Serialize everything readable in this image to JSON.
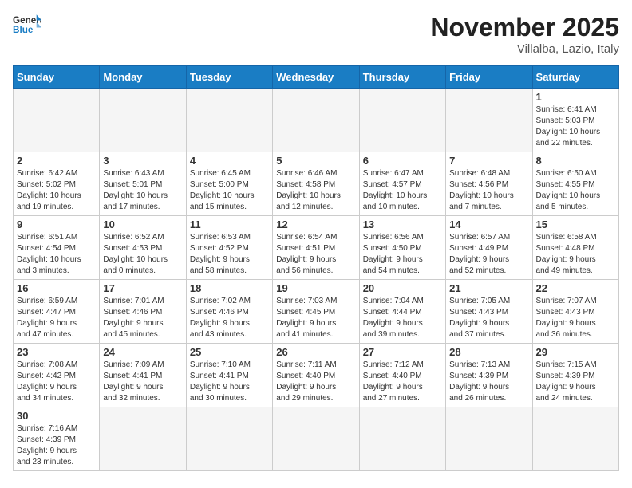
{
  "header": {
    "logo_general": "General",
    "logo_blue": "Blue",
    "month_title": "November 2025",
    "location": "Villalba, Lazio, Italy"
  },
  "weekdays": [
    "Sunday",
    "Monday",
    "Tuesday",
    "Wednesday",
    "Thursday",
    "Friday",
    "Saturday"
  ],
  "weeks": [
    [
      {
        "day": "",
        "info": ""
      },
      {
        "day": "",
        "info": ""
      },
      {
        "day": "",
        "info": ""
      },
      {
        "day": "",
        "info": ""
      },
      {
        "day": "",
        "info": ""
      },
      {
        "day": "",
        "info": ""
      },
      {
        "day": "1",
        "info": "Sunrise: 6:41 AM\nSunset: 5:03 PM\nDaylight: 10 hours\nand 22 minutes."
      }
    ],
    [
      {
        "day": "2",
        "info": "Sunrise: 6:42 AM\nSunset: 5:02 PM\nDaylight: 10 hours\nand 19 minutes."
      },
      {
        "day": "3",
        "info": "Sunrise: 6:43 AM\nSunset: 5:01 PM\nDaylight: 10 hours\nand 17 minutes."
      },
      {
        "day": "4",
        "info": "Sunrise: 6:45 AM\nSunset: 5:00 PM\nDaylight: 10 hours\nand 15 minutes."
      },
      {
        "day": "5",
        "info": "Sunrise: 6:46 AM\nSunset: 4:58 PM\nDaylight: 10 hours\nand 12 minutes."
      },
      {
        "day": "6",
        "info": "Sunrise: 6:47 AM\nSunset: 4:57 PM\nDaylight: 10 hours\nand 10 minutes."
      },
      {
        "day": "7",
        "info": "Sunrise: 6:48 AM\nSunset: 4:56 PM\nDaylight: 10 hours\nand 7 minutes."
      },
      {
        "day": "8",
        "info": "Sunrise: 6:50 AM\nSunset: 4:55 PM\nDaylight: 10 hours\nand 5 minutes."
      }
    ],
    [
      {
        "day": "9",
        "info": "Sunrise: 6:51 AM\nSunset: 4:54 PM\nDaylight: 10 hours\nand 3 minutes."
      },
      {
        "day": "10",
        "info": "Sunrise: 6:52 AM\nSunset: 4:53 PM\nDaylight: 10 hours\nand 0 minutes."
      },
      {
        "day": "11",
        "info": "Sunrise: 6:53 AM\nSunset: 4:52 PM\nDaylight: 9 hours\nand 58 minutes."
      },
      {
        "day": "12",
        "info": "Sunrise: 6:54 AM\nSunset: 4:51 PM\nDaylight: 9 hours\nand 56 minutes."
      },
      {
        "day": "13",
        "info": "Sunrise: 6:56 AM\nSunset: 4:50 PM\nDaylight: 9 hours\nand 54 minutes."
      },
      {
        "day": "14",
        "info": "Sunrise: 6:57 AM\nSunset: 4:49 PM\nDaylight: 9 hours\nand 52 minutes."
      },
      {
        "day": "15",
        "info": "Sunrise: 6:58 AM\nSunset: 4:48 PM\nDaylight: 9 hours\nand 49 minutes."
      }
    ],
    [
      {
        "day": "16",
        "info": "Sunrise: 6:59 AM\nSunset: 4:47 PM\nDaylight: 9 hours\nand 47 minutes."
      },
      {
        "day": "17",
        "info": "Sunrise: 7:01 AM\nSunset: 4:46 PM\nDaylight: 9 hours\nand 45 minutes."
      },
      {
        "day": "18",
        "info": "Sunrise: 7:02 AM\nSunset: 4:46 PM\nDaylight: 9 hours\nand 43 minutes."
      },
      {
        "day": "19",
        "info": "Sunrise: 7:03 AM\nSunset: 4:45 PM\nDaylight: 9 hours\nand 41 minutes."
      },
      {
        "day": "20",
        "info": "Sunrise: 7:04 AM\nSunset: 4:44 PM\nDaylight: 9 hours\nand 39 minutes."
      },
      {
        "day": "21",
        "info": "Sunrise: 7:05 AM\nSunset: 4:43 PM\nDaylight: 9 hours\nand 37 minutes."
      },
      {
        "day": "22",
        "info": "Sunrise: 7:07 AM\nSunset: 4:43 PM\nDaylight: 9 hours\nand 36 minutes."
      }
    ],
    [
      {
        "day": "23",
        "info": "Sunrise: 7:08 AM\nSunset: 4:42 PM\nDaylight: 9 hours\nand 34 minutes."
      },
      {
        "day": "24",
        "info": "Sunrise: 7:09 AM\nSunset: 4:41 PM\nDaylight: 9 hours\nand 32 minutes."
      },
      {
        "day": "25",
        "info": "Sunrise: 7:10 AM\nSunset: 4:41 PM\nDaylight: 9 hours\nand 30 minutes."
      },
      {
        "day": "26",
        "info": "Sunrise: 7:11 AM\nSunset: 4:40 PM\nDaylight: 9 hours\nand 29 minutes."
      },
      {
        "day": "27",
        "info": "Sunrise: 7:12 AM\nSunset: 4:40 PM\nDaylight: 9 hours\nand 27 minutes."
      },
      {
        "day": "28",
        "info": "Sunrise: 7:13 AM\nSunset: 4:39 PM\nDaylight: 9 hours\nand 26 minutes."
      },
      {
        "day": "29",
        "info": "Sunrise: 7:15 AM\nSunset: 4:39 PM\nDaylight: 9 hours\nand 24 minutes."
      }
    ],
    [
      {
        "day": "30",
        "info": "Sunrise: 7:16 AM\nSunset: 4:39 PM\nDaylight: 9 hours\nand 23 minutes."
      },
      {
        "day": "",
        "info": ""
      },
      {
        "day": "",
        "info": ""
      },
      {
        "day": "",
        "info": ""
      },
      {
        "day": "",
        "info": ""
      },
      {
        "day": "",
        "info": ""
      },
      {
        "day": "",
        "info": ""
      }
    ]
  ]
}
